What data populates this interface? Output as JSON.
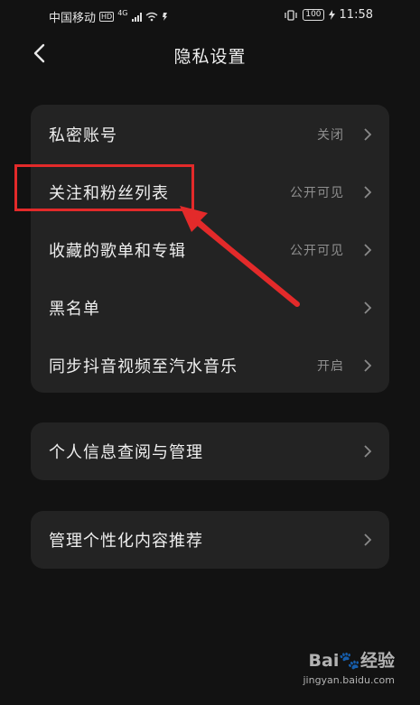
{
  "status_bar": {
    "carrier": "中国移动",
    "hd_badge": "HD",
    "network": "4G",
    "battery": "100",
    "time": "11:58"
  },
  "header": {
    "title": "隐私设置"
  },
  "settings_group_1": {
    "items": [
      {
        "label": "私密账号",
        "value": "关闭"
      },
      {
        "label": "关注和粉丝列表",
        "value": "公开可见"
      },
      {
        "label": "收藏的歌单和专辑",
        "value": "公开可见"
      },
      {
        "label": "黑名单",
        "value": ""
      },
      {
        "label": "同步抖音视频至汽水音乐",
        "value": "开启"
      }
    ]
  },
  "settings_group_2": {
    "items": [
      {
        "label": "个人信息查阅与管理",
        "value": ""
      }
    ]
  },
  "settings_group_3": {
    "items": [
      {
        "label": "管理个性化内容推荐",
        "value": ""
      }
    ]
  },
  "annotation": {
    "highlight_color": "#e32a2a"
  },
  "watermark": {
    "logo": "Bai🐾经验",
    "url": "jingyan.baidu.com"
  },
  "colors": {
    "background": "#121212",
    "card": "#232323",
    "text": "#efefef",
    "secondary_text": "#8f8f8f"
  }
}
